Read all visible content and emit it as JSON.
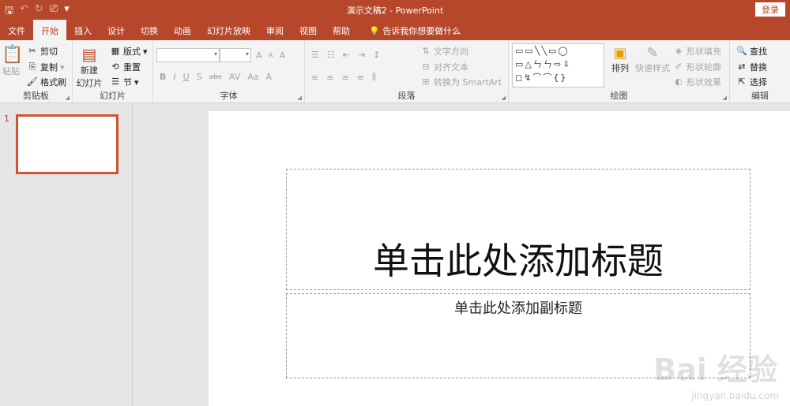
{
  "window": {
    "title": "演示文稿2  -  PowerPoint",
    "login": "登录"
  },
  "qat": {
    "save": "🖫",
    "undo": "↶",
    "redo": "↻",
    "present": "⎚",
    "more": "▾"
  },
  "tabs": [
    "文件",
    "开始",
    "插入",
    "设计",
    "切换",
    "动画",
    "幻灯片放映",
    "审阅",
    "视图",
    "帮助"
  ],
  "tellme": "告诉我你想要做什么",
  "ribbon": {
    "clipboard": {
      "label": "剪贴板",
      "paste": "粘贴",
      "cut": "剪切",
      "copy": "复制",
      "format_painter": "格式刷"
    },
    "slides": {
      "label": "幻灯片",
      "new_slide_1": "新建",
      "new_slide_2": "幻灯片",
      "layout": "版式",
      "reset": "重置",
      "section": "节"
    },
    "font": {
      "label": "字体",
      "bold": "B",
      "italic": "I",
      "underline": "U",
      "shadow": "S",
      "strike": "abc",
      "spacing": "AV",
      "case": "Aa",
      "grow": "A",
      "shrink": "A",
      "clear": "A",
      "color": "A"
    },
    "paragraph": {
      "label": "段落",
      "text_direction": "文字方向",
      "align_text": "对齐文本",
      "smartart": "转换为 SmartArt"
    },
    "drawing": {
      "label": "绘图",
      "arrange": "排列",
      "quick_styles": "快速样式",
      "fill": "形状填充",
      "outline": "形状轮廓",
      "effects": "形状效果"
    },
    "editing": {
      "label": "编辑",
      "find": "查找",
      "replace": "替换",
      "select": "选择"
    }
  },
  "slide_panel": {
    "number": "1"
  },
  "slide": {
    "title_placeholder": "单击此处添加标题",
    "subtitle_placeholder": "单击此处添加副标题"
  },
  "watermark": {
    "brand": "Bai 经验",
    "url": "jingyan.baidu.com"
  }
}
